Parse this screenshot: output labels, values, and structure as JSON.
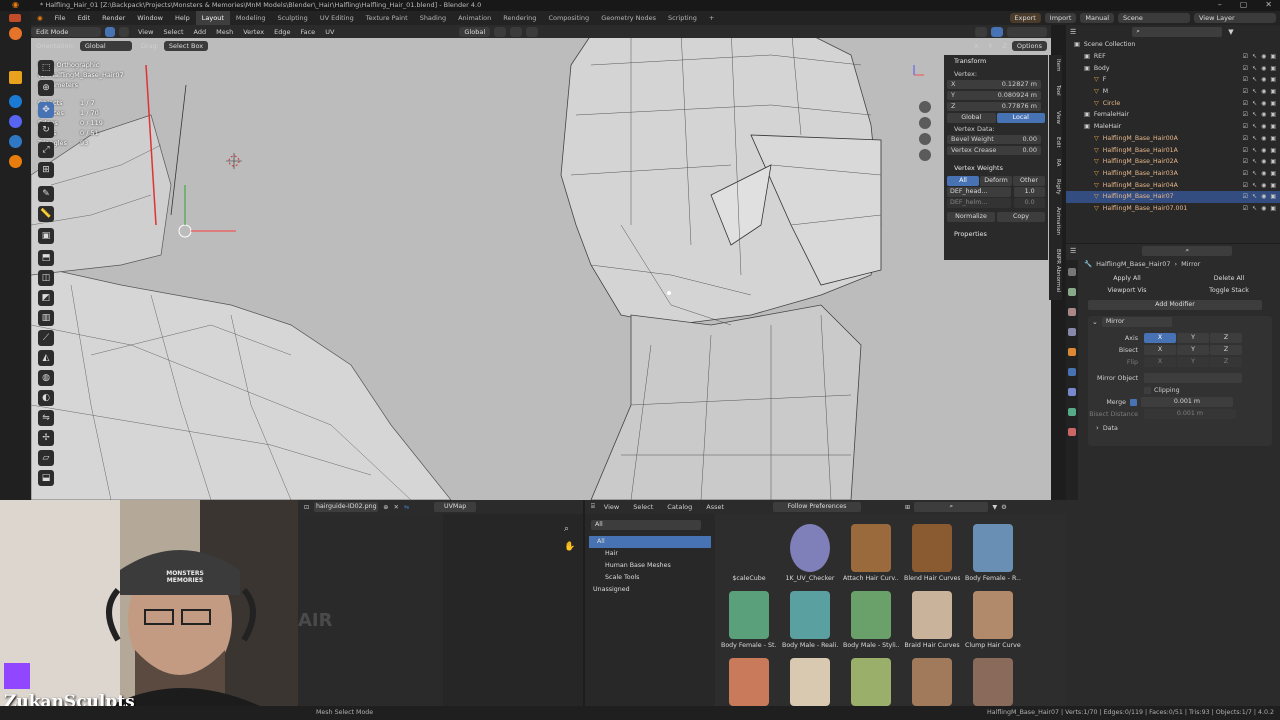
{
  "window": {
    "title": "* Halfling_Hair_01 [Z:\\Backpack\\Projects\\Monsters & Memories\\MnM Models\\Blender\\_Hair\\Halfling\\Halfling_Hair_01.blend] - Blender 4.0"
  },
  "menubar": {
    "items": [
      "File",
      "Edit",
      "Render",
      "Window",
      "Help"
    ],
    "workspaces": [
      "Layout",
      "Modeling",
      "Sculpting",
      "UV Editing",
      "Texture Paint",
      "Shading",
      "Animation",
      "Rendering",
      "Compositing",
      "Geometry Nodes",
      "Scripting"
    ],
    "active_workspace": "Layout",
    "right": [
      "Export",
      "Import",
      "Manual"
    ],
    "scene": "Scene",
    "view_layer": "View Layer"
  },
  "viewport_header": {
    "mode": "Edit Mode",
    "menus": [
      "View",
      "Select",
      "Add",
      "Mesh",
      "Vertex",
      "Edge",
      "Face",
      "UV"
    ],
    "transform_orientation": "Global",
    "orientation_label": "Orientation:",
    "orientation_value": "Global",
    "drag_label": "Drag:",
    "drag_value": "Select Box",
    "options": "Options",
    "axes": [
      "X",
      "Y",
      "Z"
    ]
  },
  "viewport_info": {
    "view": "Front Orthographic",
    "object": "(1) HalflingM_Base_Hair07",
    "units": "Centimeters",
    "stats": [
      {
        "k": "Objects",
        "v": "1 / 7"
      },
      {
        "k": "Vertices",
        "v": "1 / 70"
      },
      {
        "k": "Edges",
        "v": "0 / 119"
      },
      {
        "k": "Faces",
        "v": "0 / 51"
      },
      {
        "k": "Triangles",
        "v": "93"
      }
    ]
  },
  "npanel": {
    "transform_header": "Transform",
    "vertex_label": "Vertex:",
    "x": {
      "label": "X",
      "value": "0.12827 m"
    },
    "y": {
      "label": "Y",
      "value": "0.080924 m"
    },
    "z": {
      "label": "Z",
      "value": "0.77876 m"
    },
    "global": "Global",
    "local": "Local",
    "vertex_data": "Vertex Data:",
    "bevel_weight": {
      "label": "Bevel Weight",
      "value": "0.00"
    },
    "vertex_crease": {
      "label": "Vertex Crease",
      "value": "0.00"
    },
    "vw_header": "Vertex Weights",
    "vw_tabs": [
      "All",
      "Deform",
      "Other"
    ],
    "vw_rows": [
      {
        "name": "DEF_head...",
        "value": "1.0"
      },
      {
        "name": "DEF_helm...",
        "value": "0.0"
      }
    ],
    "normalize": "Normalize",
    "copy": "Copy",
    "properties": "Properties",
    "tabs": [
      "Item",
      "Tool",
      "View",
      "Edit",
      "RA",
      "Rigify",
      "Animation",
      "BNPR Abnormal"
    ]
  },
  "outliner": {
    "search_placeholder": "",
    "rows": [
      {
        "label": "Scene Collection",
        "indent": 0,
        "sel": false
      },
      {
        "label": "REF",
        "indent": 1,
        "sel": false
      },
      {
        "label": "Body",
        "indent": 1,
        "sel": false
      },
      {
        "label": "F",
        "indent": 2,
        "sel": false
      },
      {
        "label": "M",
        "indent": 2,
        "sel": false
      },
      {
        "label": "Circle",
        "indent": 2,
        "sel": false
      },
      {
        "label": "FemaleHair",
        "indent": 1,
        "sel": false
      },
      {
        "label": "MaleHair",
        "indent": 1,
        "sel": false
      },
      {
        "label": "HalflingM_Base_Hair00A",
        "indent": 2,
        "sel": false
      },
      {
        "label": "HalflingM_Base_Hair01A",
        "indent": 2,
        "sel": false
      },
      {
        "label": "HalflingM_Base_Hair02A",
        "indent": 2,
        "sel": false
      },
      {
        "label": "HalflingM_Base_Hair03A",
        "indent": 2,
        "sel": false
      },
      {
        "label": "HalflingM_Base_Hair04A",
        "indent": 2,
        "sel": false
      },
      {
        "label": "HalflingM_Base_Hair07",
        "indent": 2,
        "sel": true
      },
      {
        "label": "HalflingM_Base_Hair07.001",
        "indent": 2,
        "sel": false
      }
    ]
  },
  "properties": {
    "breadcrumb_object": "HalflingM_Base_Hair07",
    "breadcrumb_sep": "›",
    "breadcrumb_tab": "Mirror",
    "apply_all": "Apply All",
    "delete_all": "Delete All",
    "viewport_vis": "Viewport Vis",
    "toggle_stack": "Toggle Stack",
    "add_modifier": "Add Modifier",
    "modifier_name": "Mirror",
    "axis_label": "Axis",
    "bisect_label": "Bisect",
    "flip_label": "Flip",
    "axes": [
      "X",
      "Y",
      "Z"
    ],
    "mirror_object": "Mirror Object",
    "clipping": "Clipping",
    "merge": "Merge",
    "merge_value": "0.001 m",
    "bisect_distance": "Bisect Distance",
    "bisect_distance_value": "0.001 m",
    "data": "Data"
  },
  "image_editor": {
    "image_name": "hairguide-ID02.png",
    "uvmap": "UVMap",
    "overlay_text": "AIR"
  },
  "asset_browser": {
    "menus": [
      "View",
      "Select",
      "Catalog",
      "Asset"
    ],
    "library": "Follow Preferences",
    "filter": "All",
    "tree": [
      {
        "label": "All",
        "indent": 0,
        "sel": true
      },
      {
        "label": "Hair",
        "indent": 1,
        "sel": false
      },
      {
        "label": "Human Base Meshes",
        "indent": 1,
        "sel": false
      },
      {
        "label": "Scale Tools",
        "indent": 1,
        "sel": false
      },
      {
        "label": "Unassigned",
        "indent": 0,
        "sel": false
      }
    ],
    "assets": [
      {
        "label": "$caleCube",
        "color": "#2d2d2d"
      },
      {
        "label": "1K_UV_Checker",
        "color": "#7f7fb9"
      },
      {
        "label": "Attach Hair Curv...",
        "color": "#9a6a3c"
      },
      {
        "label": "Blend Hair Curves",
        "color": "#8a5a30"
      },
      {
        "label": "Body Female - R...",
        "color": "#6a8fb5"
      },
      {
        "label": "Body Female - St...",
        "color": "#5aa07a"
      },
      {
        "label": "Body Male - Reali...",
        "color": "#5aa0a0"
      },
      {
        "label": "Body Male - Styli...",
        "color": "#6aa06a"
      },
      {
        "label": "Braid Hair Curves",
        "color": "#c9b39a"
      },
      {
        "label": "Clump Hair Curves",
        "color": "#b08a6a"
      },
      {
        "label": "",
        "color": "#c97a5a"
      },
      {
        "label": "",
        "color": "#d9c9b0"
      },
      {
        "label": "",
        "color": "#9ab06a"
      },
      {
        "label": "",
        "color": "#a07a5a"
      },
      {
        "label": "",
        "color": "#8a6a5a"
      }
    ]
  },
  "webcam": {
    "channel": "ZukanSculpts",
    "cap_text": "MONSTERS MEMORIES"
  },
  "statusbar": {
    "left": "Mesh Select Mode",
    "right": "HalflingM_Base_Hair07 | Verts:1/70 | Edges:0/119 | Faces:0/51 | Tris:93 | Objects:1/7 | 4.0.2"
  },
  "colors": {
    "accent": "#4772b3",
    "selection": "#334d80",
    "viewport_bg": "#b9b9b9"
  }
}
